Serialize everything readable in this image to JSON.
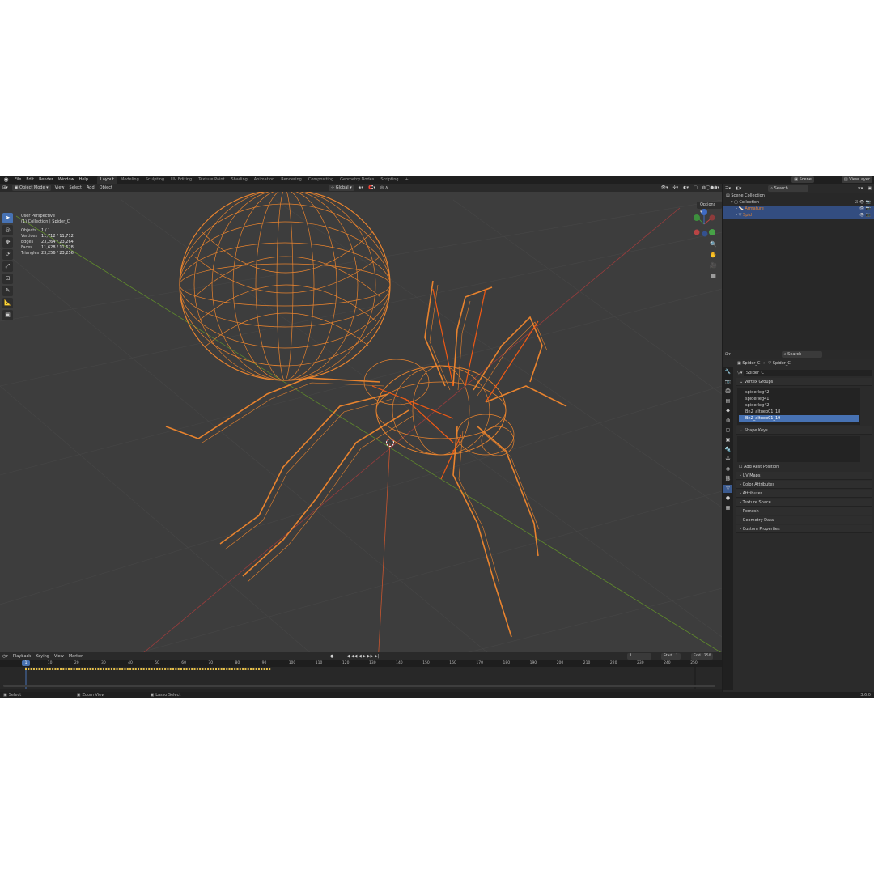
{
  "menu": {
    "file": "File",
    "edit": "Edit",
    "render": "Render",
    "window": "Window",
    "help": "Help"
  },
  "workspaces": [
    "Layout",
    "Modeling",
    "Sculpting",
    "UV Editing",
    "Texture Paint",
    "Shading",
    "Animation",
    "Rendering",
    "Compositing",
    "Geometry Nodes",
    "Scripting"
  ],
  "scene": {
    "scene_name": "Scene",
    "view_layer": "ViewLayer"
  },
  "viewport": {
    "mode": "Object Mode",
    "menus": [
      "View",
      "Select",
      "Add",
      "Object"
    ],
    "orientation": "Global",
    "options": "Options",
    "view_name": "User Perspective",
    "collection_path": "(1) Collection | Spider_C",
    "stats": [
      {
        "key": "Objects",
        "val": "1 / 1"
      },
      {
        "key": "Vertices",
        "val": "11,712 / 11,712"
      },
      {
        "key": "Edges",
        "val": "23,264 / 23,264"
      },
      {
        "key": "Faces",
        "val": "11,628 / 11,628"
      },
      {
        "key": "Triangles",
        "val": "23,256 / 23,256"
      }
    ],
    "wire_color": "#e8832e",
    "bg_color": "#3d3d3d"
  },
  "timeline": {
    "menus": [
      "Playback",
      "Keying",
      "View",
      "Marker"
    ],
    "current_frame": "1",
    "frame_field": "1",
    "start_label": "Start",
    "start": "1",
    "end_label": "End",
    "end": "250",
    "ticks": [
      "10",
      "20",
      "30",
      "40",
      "50",
      "60",
      "70",
      "80",
      "90",
      "100",
      "110",
      "120",
      "130",
      "140",
      "150",
      "160",
      "170",
      "180",
      "190",
      "200",
      "210",
      "220",
      "230",
      "240",
      "250"
    ]
  },
  "statusbar": {
    "select": "Select",
    "zoom": "Zoom View",
    "lasso": "Lasso Select",
    "version": "3.6.0"
  },
  "outliner": {
    "search_placeholder": "Search",
    "scene_collection": "Scene Collection",
    "collection": "Collection",
    "armature": "Armature",
    "spider": "Spid"
  },
  "properties": {
    "search_placeholder": "Search",
    "breadcrumb_obj": "Spider_C",
    "breadcrumb_mesh": "Spider_C",
    "mesh_name": "Spider_C",
    "vertex_groups_label": "Vertex Groups",
    "vertex_groups": [
      "spiderleg42",
      "spiderleg41",
      "spiderleg42",
      "Bn2_altueb01_18",
      "Bn2_altueb01_19"
    ],
    "shape_keys_label": "Shape Keys",
    "add_rest": "Add Rest Position",
    "panels": [
      "UV Maps",
      "Color Attributes",
      "Attributes",
      "Texture Space",
      "Remesh",
      "Geometry Data",
      "Custom Properties"
    ]
  }
}
